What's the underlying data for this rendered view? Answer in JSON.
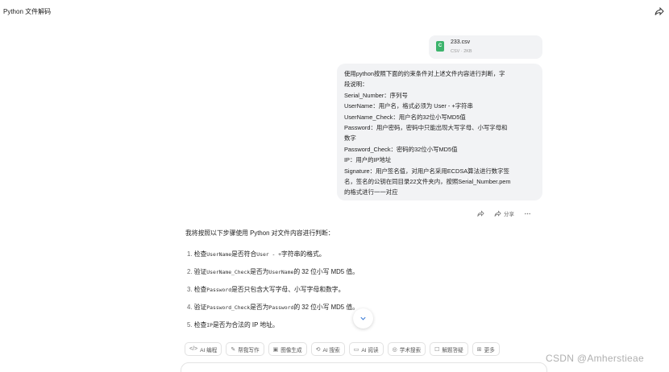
{
  "header": {
    "title": "Python 文件解码",
    "share_icon": "share-icon"
  },
  "attachment": {
    "icon_label": "C",
    "name": "233.csv",
    "meta": "CSV · 2KB",
    "icon_color": "#3db46d"
  },
  "user_message": {
    "lines": [
      "使用python按照下面的约束条件对上述文件内容进行判断，字",
      "段说明：",
      "Serial_Number：序列号",
      "UserName：用户名，格式必须为 User - +字符串",
      "UserName_Check：用户名的32位小写MD5值",
      "Password：用户密码，密码中只能出现大写字母、小写字母和",
      "数字",
      "Password_Check：密码的32位小写MD5值",
      "IP：用户的IP地址",
      "Signature：用户签名值，对用户名采用ECDSA算法进行数字签",
      "名，签名的公钥在同目录22文件夹内，按照Serial_Number.pem",
      "的格式进行一一对应"
    ]
  },
  "message_actions": {
    "share_label": "分享"
  },
  "answer": {
    "intro": "我将按照以下步骤使用 Python 对文件内容进行判断：",
    "steps": [
      {
        "num": "1.",
        "pre": "检查",
        "code": "UserName",
        "mid": "是否符合",
        "code2": "User - +",
        "post": "字符串的格式。"
      },
      {
        "num": "2.",
        "pre": "验证",
        "code": "UserName_Check",
        "mid": "是否为",
        "code2": "UserName",
        "post": "的 32 位小写 MD5 值。"
      },
      {
        "num": "3.",
        "pre": "检查",
        "code": "Password",
        "mid": "是否只包含大写字母、小写字母和数字。",
        "code2": "",
        "post": ""
      },
      {
        "num": "4.",
        "pre": "验证",
        "code": "Password_Check",
        "mid": "是否为",
        "code2": "Password",
        "post": "的 32 位小写 MD5 值。"
      },
      {
        "num": "5.",
        "pre": "检查",
        "code": "IP",
        "mid": "是否为合法的 IP 地址。",
        "code2": "",
        "post": ""
      }
    ]
  },
  "toolbar": {
    "items": [
      {
        "icon": "</>",
        "label": "AI 编程"
      },
      {
        "icon": "✎",
        "label": "帮我写作"
      },
      {
        "icon": "▣",
        "label": "图像生成"
      },
      {
        "icon": "⟲",
        "label": "AI 搜索"
      },
      {
        "icon": "▭",
        "label": "AI 阅读"
      },
      {
        "icon": "◎",
        "label": "学术搜索"
      },
      {
        "icon": "☐",
        "label": "解题答疑"
      },
      {
        "icon": "⊞",
        "label": "更多"
      }
    ]
  },
  "watermark": "CSDN @Amherstieae"
}
